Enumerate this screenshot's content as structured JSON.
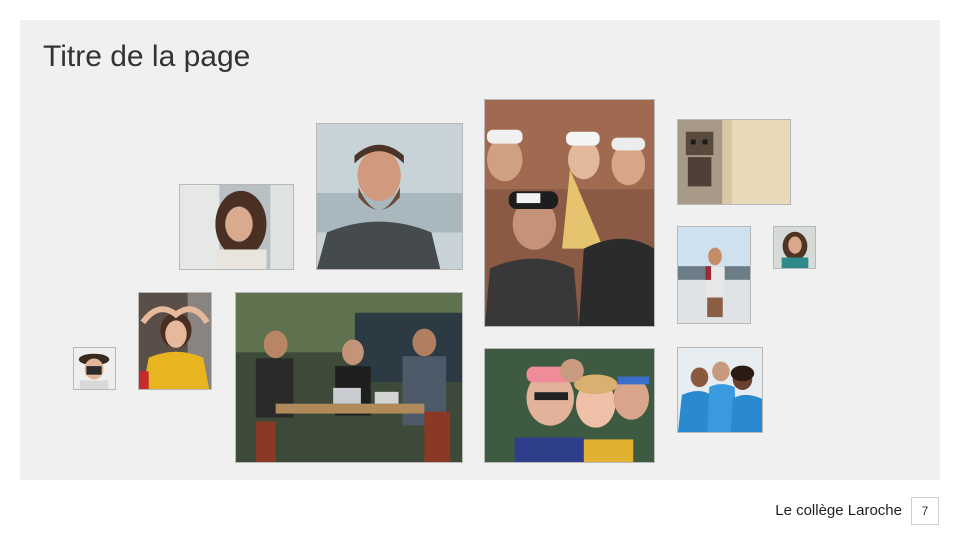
{
  "page": {
    "title": "Titre de la page",
    "footer_text": "Le collège Laroche",
    "page_number": "7"
  },
  "colors": {
    "panel": "#f0f0f0",
    "text": "#333333"
  },
  "photos": [
    {
      "id": "woman-window",
      "icon": "portrait-photo"
    },
    {
      "id": "bearded-man-sea",
      "icon": "portrait-photo"
    },
    {
      "id": "friends-caps-group",
      "icon": "group-photo"
    },
    {
      "id": "robot-toy",
      "icon": "object-photo"
    },
    {
      "id": "man-beach",
      "icon": "portrait-photo"
    },
    {
      "id": "woman-curly-small",
      "icon": "portrait-photo"
    },
    {
      "id": "girl-camera",
      "icon": "portrait-photo"
    },
    {
      "id": "woman-yellow",
      "icon": "portrait-photo"
    },
    {
      "id": "team-laptops",
      "icon": "group-photo"
    },
    {
      "id": "women-selfie",
      "icon": "group-photo"
    },
    {
      "id": "volunteers-blue",
      "icon": "group-photo"
    }
  ]
}
